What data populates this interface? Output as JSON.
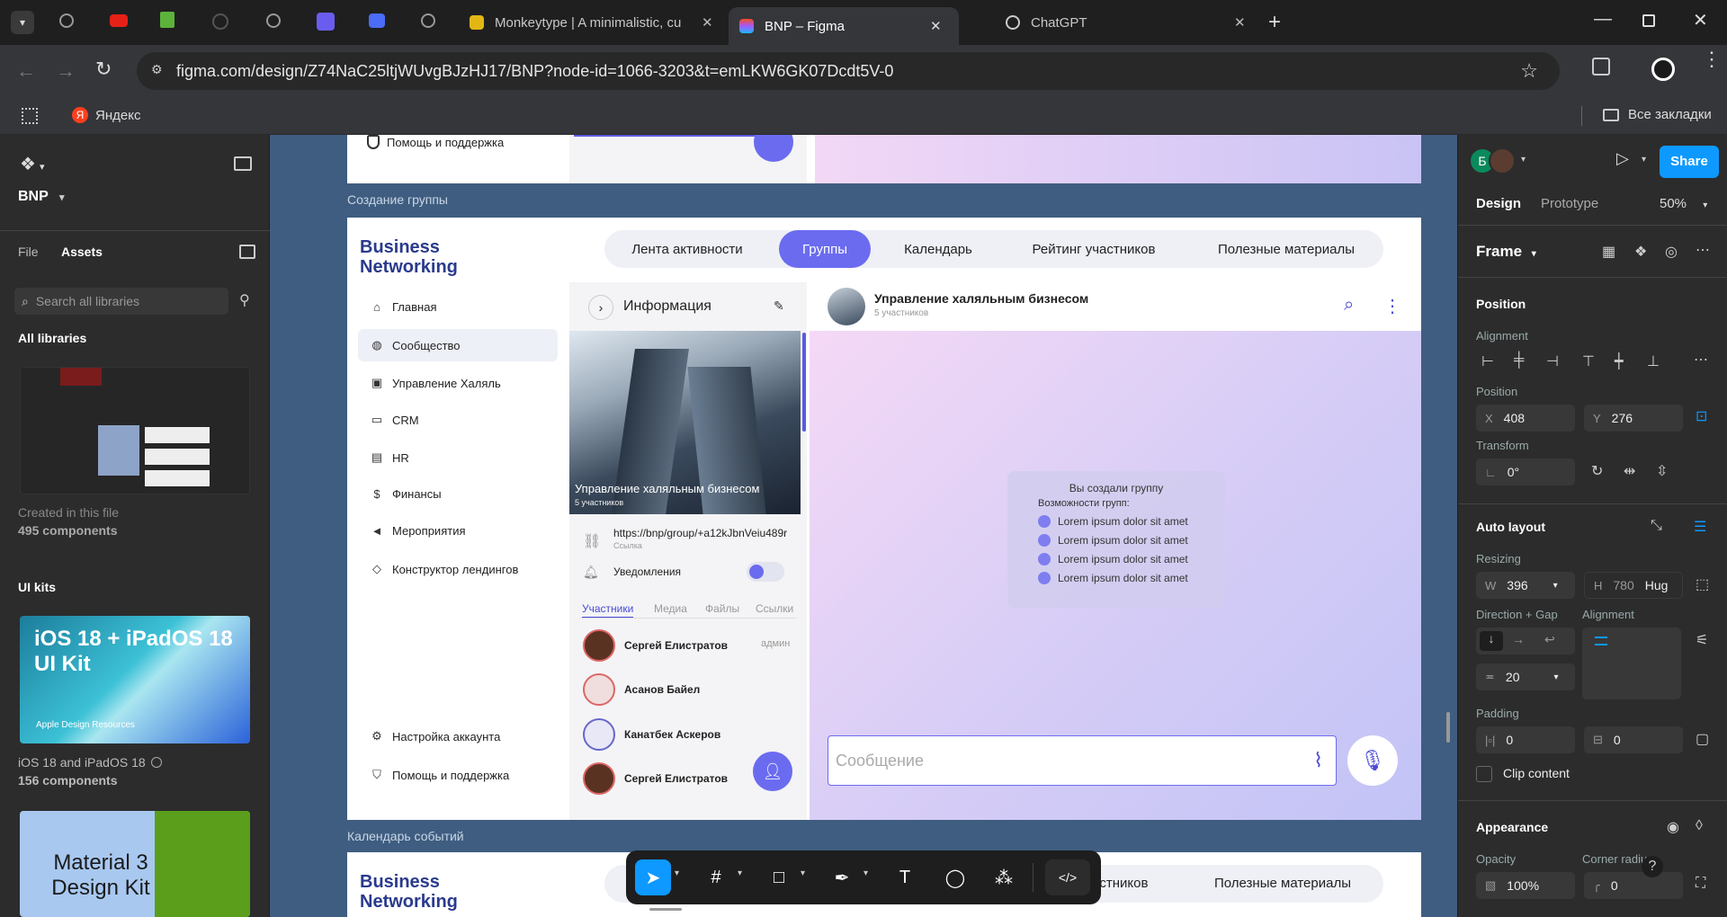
{
  "browser": {
    "tabs": [
      {
        "title": "Monkeytype | A minimalistic, cu"
      },
      {
        "title": "BNP – Figma"
      },
      {
        "title": "ChatGPT"
      }
    ],
    "url": "figma.com/design/Z74NaC25ltjWUvgBJzHJ17/BNP?node-id=1066-3203&t=emLKW6GK07Dcdt5V-0",
    "bookmark_yandex": "Яндекс",
    "all_bookmarks": "Все закладки"
  },
  "left": {
    "project": "BNP",
    "tab_file": "File",
    "tab_assets": "Assets",
    "search_placeholder": "Search all libraries",
    "all_libraries": "All libraries",
    "created_in_file": "Created in this file",
    "components_count": "495 components",
    "ui_kits": "UI kits",
    "ios_title": "iOS 18 + iPadOS 18 UI Kit",
    "ios_sub": "Apple Design Resources",
    "ios_name": "iOS 18 and iPadOS 18",
    "ios_count": "156 components",
    "material_title": "Material 3 Design Kit"
  },
  "canvas": {
    "frame_label_top": "Создание группы",
    "frame_label_bottom": "Календарь событий",
    "help_top": "Помощь и поддержка",
    "logo_line1": "Business",
    "logo_line2": "Networking",
    "pills": [
      "Лента активности",
      "Группы",
      "Календарь",
      "Рейтинг участников",
      "Полезные материалы"
    ],
    "nav": [
      "Главная",
      "Сообщество",
      "Управление Халяль",
      "CRM",
      "HR",
      "Финансы",
      "Мероприятия",
      "Конструктор лендингов"
    ],
    "nav_bottom": [
      "Настройка аккаунта",
      "Помощь и поддержка"
    ],
    "info_title": "Информация",
    "group_name": "Управление халяльным бизнесом",
    "group_members": "5 участников",
    "link": "https://bnp/group/+a12kJbnVeiu489r",
    "link_label": "Ссылка",
    "notifications": "Уведомления",
    "member_tabs": [
      "Участники",
      "Медиа",
      "Файлы",
      "Ссылки"
    ],
    "members": [
      {
        "name": "Сергей Елистратов",
        "role": "админ"
      },
      {
        "name": "Асанов Байел",
        "role": ""
      },
      {
        "name": "Канатбек Аскеров",
        "role": ""
      },
      {
        "name": "Сергей Елистратов",
        "role": ""
      }
    ],
    "chat_title": "Управление халяльным бизнесом",
    "chat_sub": "5 участников",
    "sys_title": "Вы создали группу",
    "sys_sub": "Возможности групп:",
    "sys_items": [
      "Lorem ipsum dolor sit amet",
      "Lorem ipsum dolor sit amet",
      "Lorem ipsum dolor sit amet",
      "Lorem ipsum dolor sit amet"
    ],
    "message_placeholder": "Сообщение",
    "bottom_pills": [
      "астников",
      "Полезные материалы"
    ]
  },
  "right": {
    "avatar_letter": "Б",
    "share": "Share",
    "tab_design": "Design",
    "tab_prototype": "Prototype",
    "zoom": "50%",
    "frame": "Frame",
    "position": "Position",
    "alignment": "Alignment",
    "position_label": "Position",
    "x_label": "X",
    "x": "408",
    "y_label": "Y",
    "y": "276",
    "transform": "Transform",
    "rotation": "0°",
    "auto_layout": "Auto layout",
    "resizing": "Resizing",
    "w_label": "W",
    "w": "396",
    "h_label": "H",
    "h": "780",
    "hug": "Hug",
    "direction_gap": "Direction + Gap",
    "alignment2": "Alignment",
    "gap": "20",
    "padding": "Padding",
    "pad_h": "0",
    "pad_v": "0",
    "clip": "Clip content",
    "appearance": "Appearance",
    "opacity_label": "Opacity",
    "opacity": "100%",
    "corner_label": "Corner radius",
    "corner": "0"
  }
}
